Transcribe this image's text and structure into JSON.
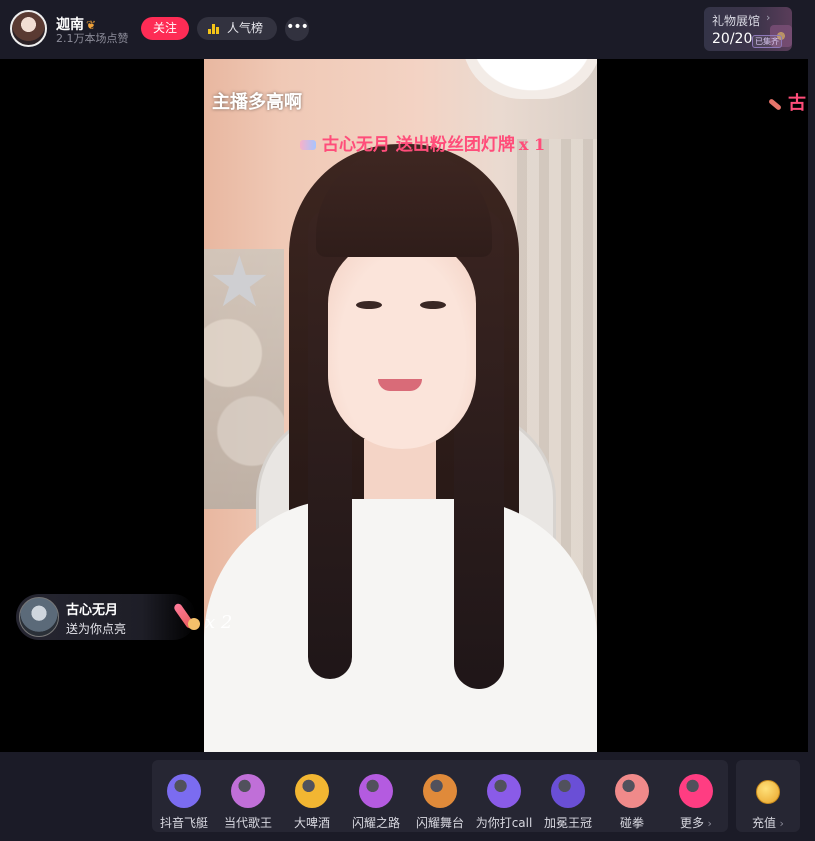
{
  "host": {
    "name": "迦南",
    "badge_icon": "butterfly-icon",
    "likes": "2.1万本场点赞"
  },
  "header": {
    "follow_label": "关注",
    "rank_label": "人气榜",
    "more_icon": "more-dots-icon",
    "gift_hall": {
      "label": "礼物展馆",
      "count": "20/20",
      "badge": "已集齐"
    }
  },
  "stream": {
    "caption": "主播多高啊",
    "gift_banner": {
      "user": "古心无月",
      "text": "送出粉丝团灯牌",
      "count": "x 1"
    },
    "edge_banner_text": "古",
    "gift_popup": {
      "user": "古心无月",
      "text": "送为你点亮",
      "combo": "x 2"
    }
  },
  "gift_bar": {
    "items": [
      {
        "label": "抖音飞艇",
        "icon": "airship-icon",
        "color": "#7b6cf0"
      },
      {
        "label": "当代歌王",
        "icon": "singer-icon",
        "color": "#c06fd8"
      },
      {
        "label": "大啤酒",
        "icon": "beer-icon",
        "color": "#f2b632"
      },
      {
        "label": "闪耀之路",
        "icon": "road-icon",
        "color": "#b45be0"
      },
      {
        "label": "闪耀舞台",
        "icon": "stage-icon",
        "color": "#e08a3a"
      },
      {
        "label": "为你打call",
        "icon": "call-icon",
        "color": "#8a5be8"
      },
      {
        "label": "加冕王冠",
        "icon": "crown-icon",
        "color": "#6a4fd6"
      },
      {
        "label": "碰拳",
        "icon": "fist-icon",
        "color": "#f08a8a"
      },
      {
        "label": "更多",
        "icon": "gift-box-icon",
        "color": "#ff3d82"
      }
    ],
    "recharge_label": "充值"
  }
}
